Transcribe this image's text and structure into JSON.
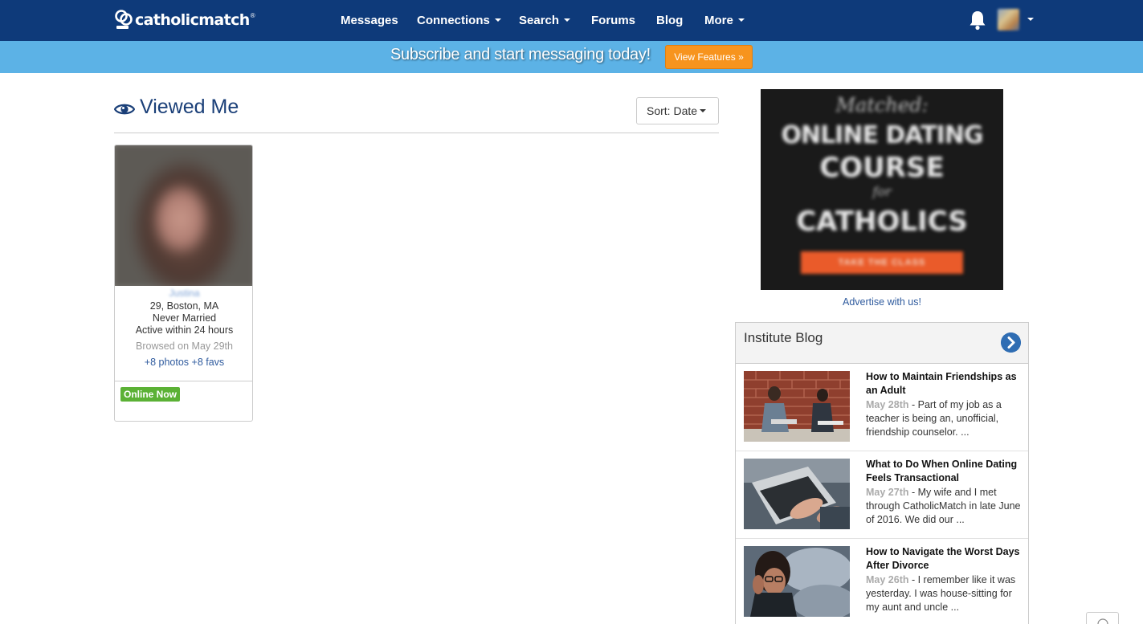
{
  "nav": {
    "logo_text": "catholicmatch",
    "logo_reg": "®",
    "items": [
      {
        "label": "Messages"
      },
      {
        "label": "Connections"
      },
      {
        "label": "Search"
      },
      {
        "label": "Forums"
      },
      {
        "label": "Blog"
      },
      {
        "label": "More"
      }
    ]
  },
  "banner": {
    "text": "Subscribe and start messaging today!",
    "button": "View Features »"
  },
  "page": {
    "title": "Viewed Me",
    "sort_label": "Sort: Date"
  },
  "profile": {
    "name": "Justina",
    "age_location": "29, Boston, MA",
    "status": "Never Married",
    "activity": "Active within 24 hours",
    "browsed": "Browsed on May 29th",
    "links": "+8 photos +8 favs",
    "badge": "Online Now"
  },
  "ad": {
    "script_line": "Matched:",
    "line1": "ONLINE DATING",
    "line2": "COURSE",
    "line3": "for",
    "line4": "CATHOLICS",
    "cta": "TAKE THE CLASS",
    "advertise_link": "Advertise with us!"
  },
  "blog": {
    "title": "Institute Blog",
    "posts": [
      {
        "title": "How to Maintain Friendships as an Adult",
        "date": "May 28th",
        "excerpt": " - Part of my job as a teacher is being an, unofficial, friendship counselor. ..."
      },
      {
        "title": "What to Do When Online Dating Feels Transactional",
        "date": "May 27th",
        "excerpt": " - My wife and I met through CatholicMatch in late June of 2016. We did our ..."
      },
      {
        "title": "How to Navigate the Worst Days After Divorce",
        "date": "May 26th",
        "excerpt": " - I remember like it was yesterday. I was house-sitting for my aunt and uncle ..."
      }
    ]
  }
}
